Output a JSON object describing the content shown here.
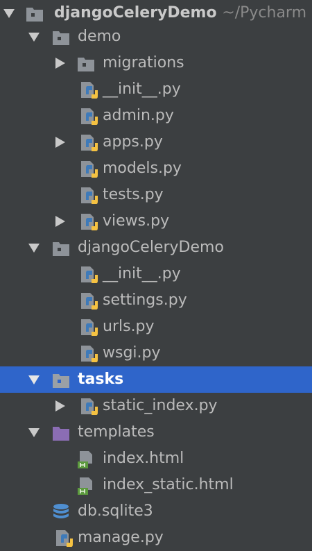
{
  "tree": {
    "root": {
      "label": "djangoCeleryDemo",
      "path": "~/Pycharm"
    },
    "items": [
      {
        "label": "demo"
      },
      {
        "label": "migrations"
      },
      {
        "label": "__init__.py"
      },
      {
        "label": "admin.py"
      },
      {
        "label": "apps.py"
      },
      {
        "label": "models.py"
      },
      {
        "label": "tests.py"
      },
      {
        "label": "views.py"
      },
      {
        "label": "djangoCeleryDemo"
      },
      {
        "label": "__init__.py"
      },
      {
        "label": "settings.py"
      },
      {
        "label": "urls.py"
      },
      {
        "label": "wsgi.py"
      },
      {
        "label": "tasks"
      },
      {
        "label": "static_index.py"
      },
      {
        "label": "templates"
      },
      {
        "label": "index.html"
      },
      {
        "label": "index_static.html"
      },
      {
        "label": "db.sqlite3"
      },
      {
        "label": "manage.py"
      }
    ]
  },
  "colors": {
    "background": "#3c3f41",
    "selection": "#2f65ca",
    "text": "#bbbbbb",
    "folder": "#8e9399",
    "templates_folder": "#8b6db4",
    "python_blue": "#3e7ab9",
    "python_yellow": "#f5c242",
    "html_green": "#5c9a3e",
    "db_blue": "#4f8fd1"
  }
}
